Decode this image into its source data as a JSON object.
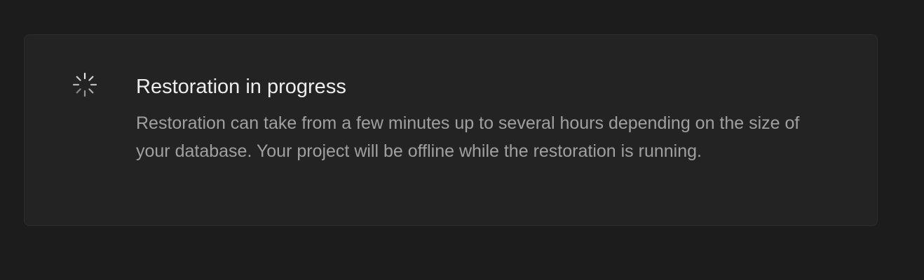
{
  "alert": {
    "icon": "loading-spinner-icon",
    "title": "Restoration in progress",
    "description": "Restoration can take from a few minutes up to several hours depending on the size of your database. Your project will be offline while the restoration is running."
  },
  "colors": {
    "page_background": "#1c1c1c",
    "card_background": "#232323",
    "title_text": "#ededed",
    "body_text": "#a0a0a0"
  }
}
